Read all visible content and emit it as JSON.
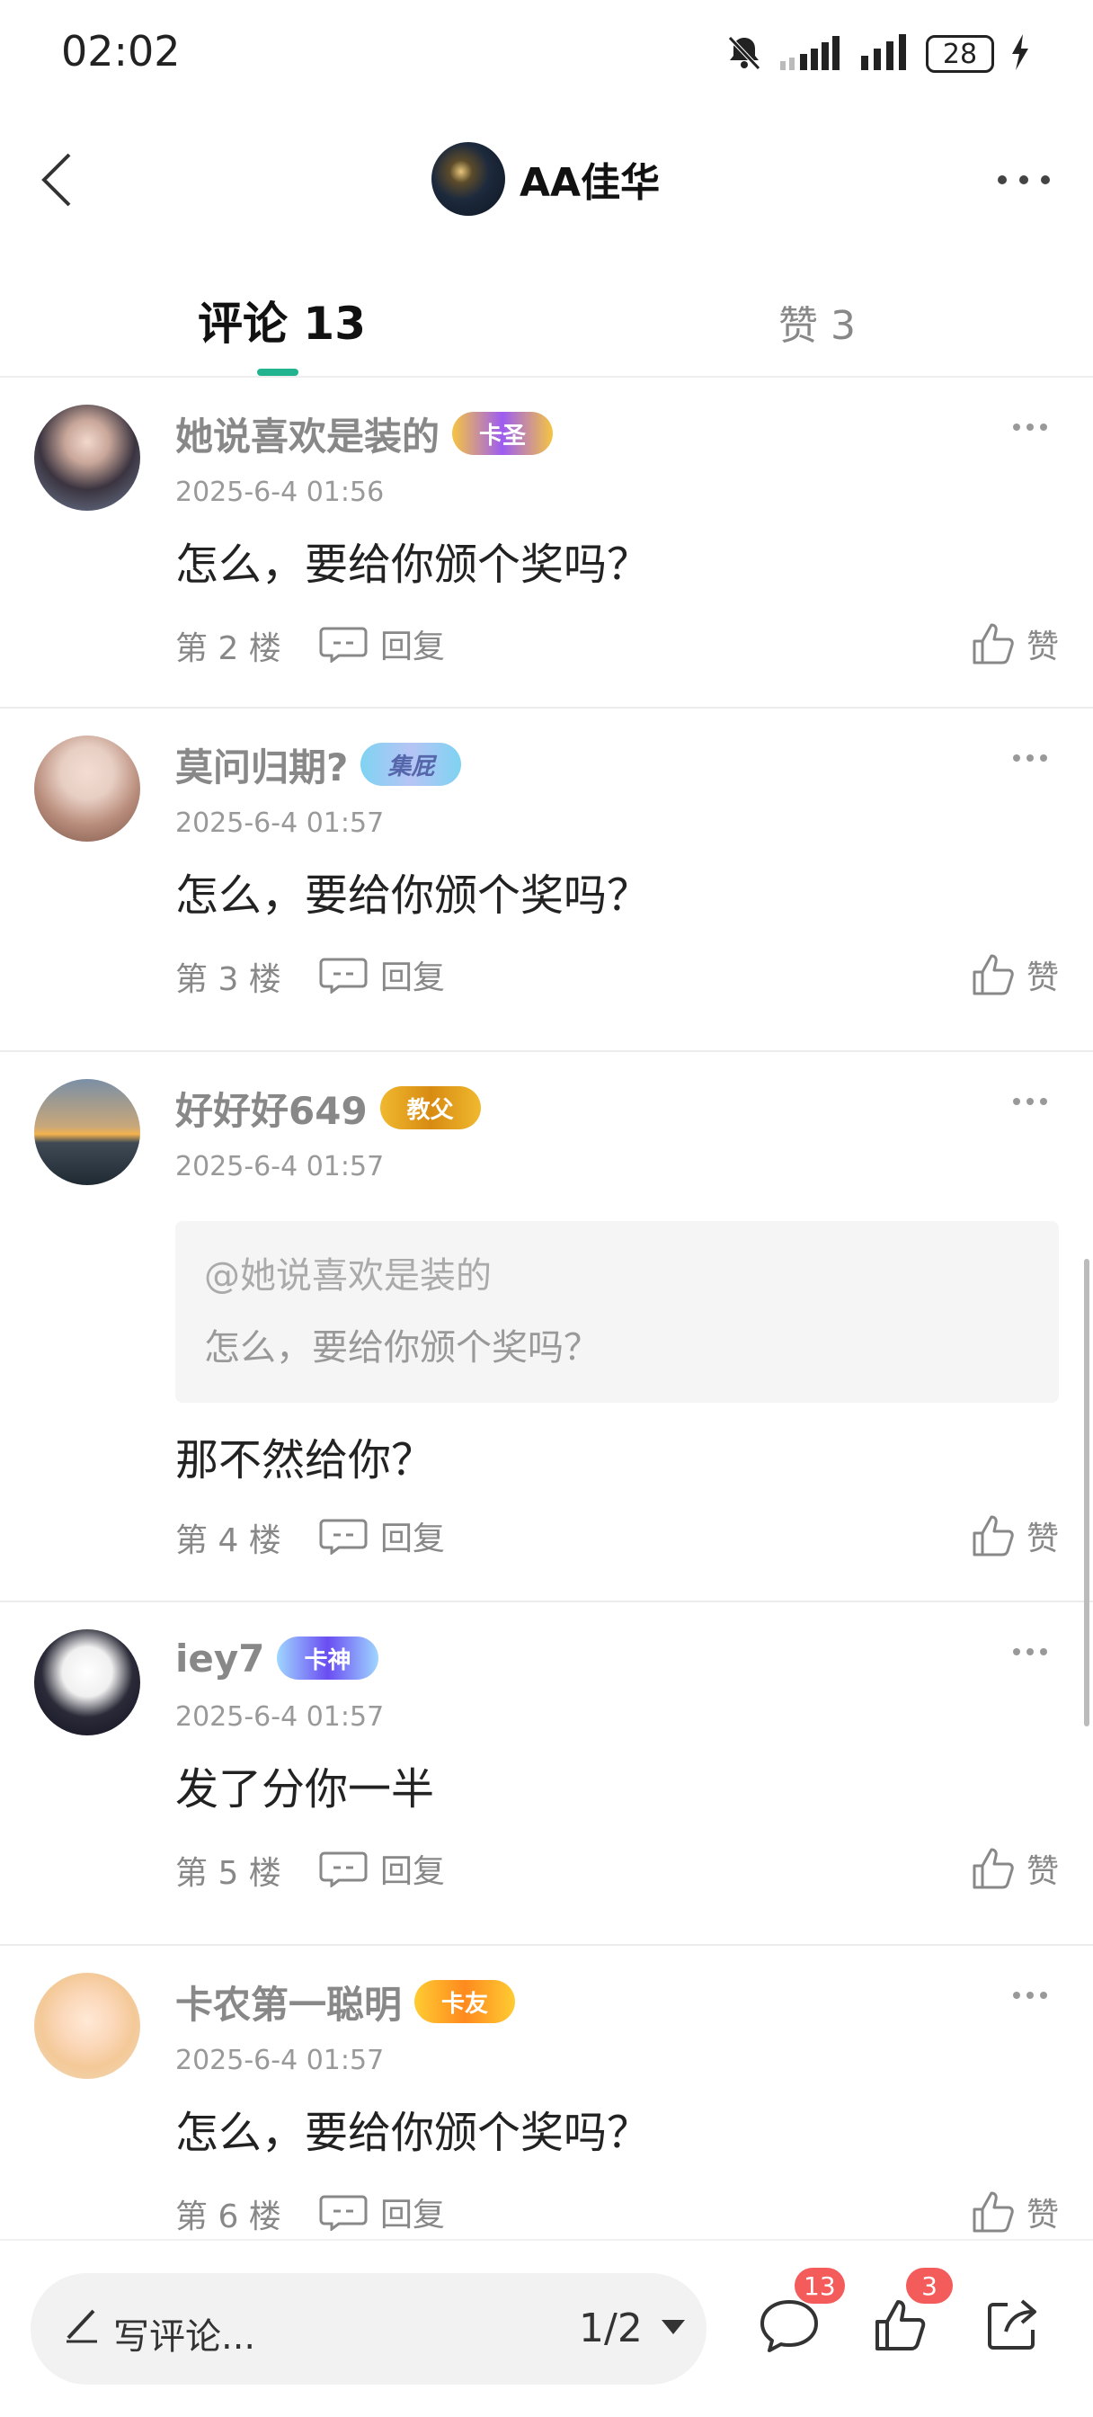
{
  "status_bar": {
    "time": "02:02",
    "battery": "28"
  },
  "nav": {
    "title": "AA佳华"
  },
  "tabs": {
    "comments": "评论 13",
    "likes": "赞 3"
  },
  "comments": [
    {
      "name": "她说喜欢是装的",
      "badge": "卡圣",
      "date": "2025-6-4 01:56",
      "text": "怎么，要给你颁个奖吗？",
      "floor": "第 2 楼",
      "reply": "回复",
      "like": "赞"
    },
    {
      "name": "莫问归期?",
      "badge": "集屁",
      "date": "2025-6-4 01:57",
      "text": "怎么，要给你颁个奖吗？",
      "floor": "第 3 楼",
      "reply": "回复",
      "like": "赞"
    },
    {
      "name": "好好好649",
      "badge": "教父",
      "date": "2025-6-4 01:57",
      "quote_at": "@她说喜欢是装的",
      "quote_text": "怎么，要给你颁个奖吗？",
      "text": "那不然给你？",
      "floor": "第 4 楼",
      "reply": "回复",
      "like": "赞"
    },
    {
      "name": "iey7",
      "badge": "卡神",
      "date": "2025-6-4 01:57",
      "text": "发了分你一半",
      "floor": "第 5 楼",
      "reply": "回复",
      "like": "赞"
    },
    {
      "name": "卡农第一聪明",
      "badge": "卡友",
      "date": "2025-6-4 01:57",
      "text": "怎么，要给你颁个奖吗？",
      "floor": "第 6 楼",
      "reply": "回复",
      "like": "赞"
    }
  ],
  "bottom_bar": {
    "placeholder": "写评论...",
    "pager": "1/2",
    "comment_count": "13",
    "like_count": "3"
  },
  "colors": {
    "accent": "#22b38f",
    "badge_red": "#f45b5b"
  }
}
